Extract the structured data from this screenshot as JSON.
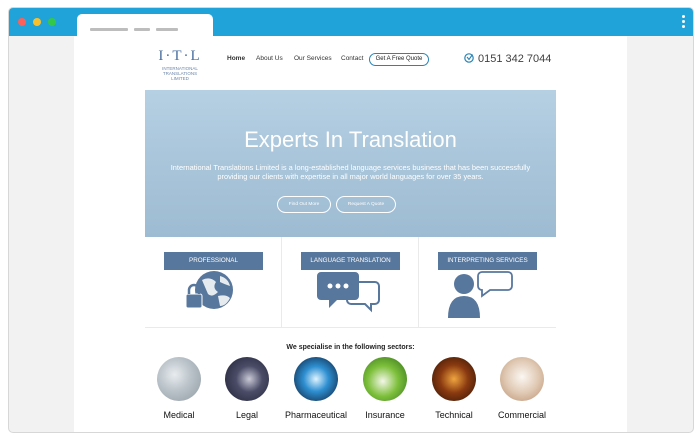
{
  "logo": {
    "mark": "I·T·L",
    "company": "INTERNATIONAL TRANSLATIONS LIMITED"
  },
  "nav": {
    "items": [
      "Home",
      "About Us",
      "Our Services",
      "Contact"
    ],
    "cta": "Get A Free Quote"
  },
  "phone": "0151 342 7044",
  "hero": {
    "title": "Experts In Translation",
    "text": "International Translations Limited is a long-established language services business that has been successfully providing our clients with expertise in all major world languages for over 35 years.",
    "button1": "Find Out More",
    "button2": "Request A Quote"
  },
  "services": [
    {
      "label": "PROFESSIONAL",
      "icon": "globe-lock-icon"
    },
    {
      "label": "LANGUAGE TRANSLATION",
      "icon": "speech-bubbles-icon"
    },
    {
      "label": "INTERPRETING SERVICES",
      "icon": "speaker-icon"
    }
  ],
  "sectors_title": "We specialise in the following sectors:",
  "sectors": [
    "Medical",
    "Legal",
    "Pharmaceutical",
    "Insurance",
    "Technical",
    "Commercial"
  ],
  "colors": {
    "chrome": "#1fa3d8",
    "accent": "#58779c",
    "hero": "#aac6db"
  }
}
